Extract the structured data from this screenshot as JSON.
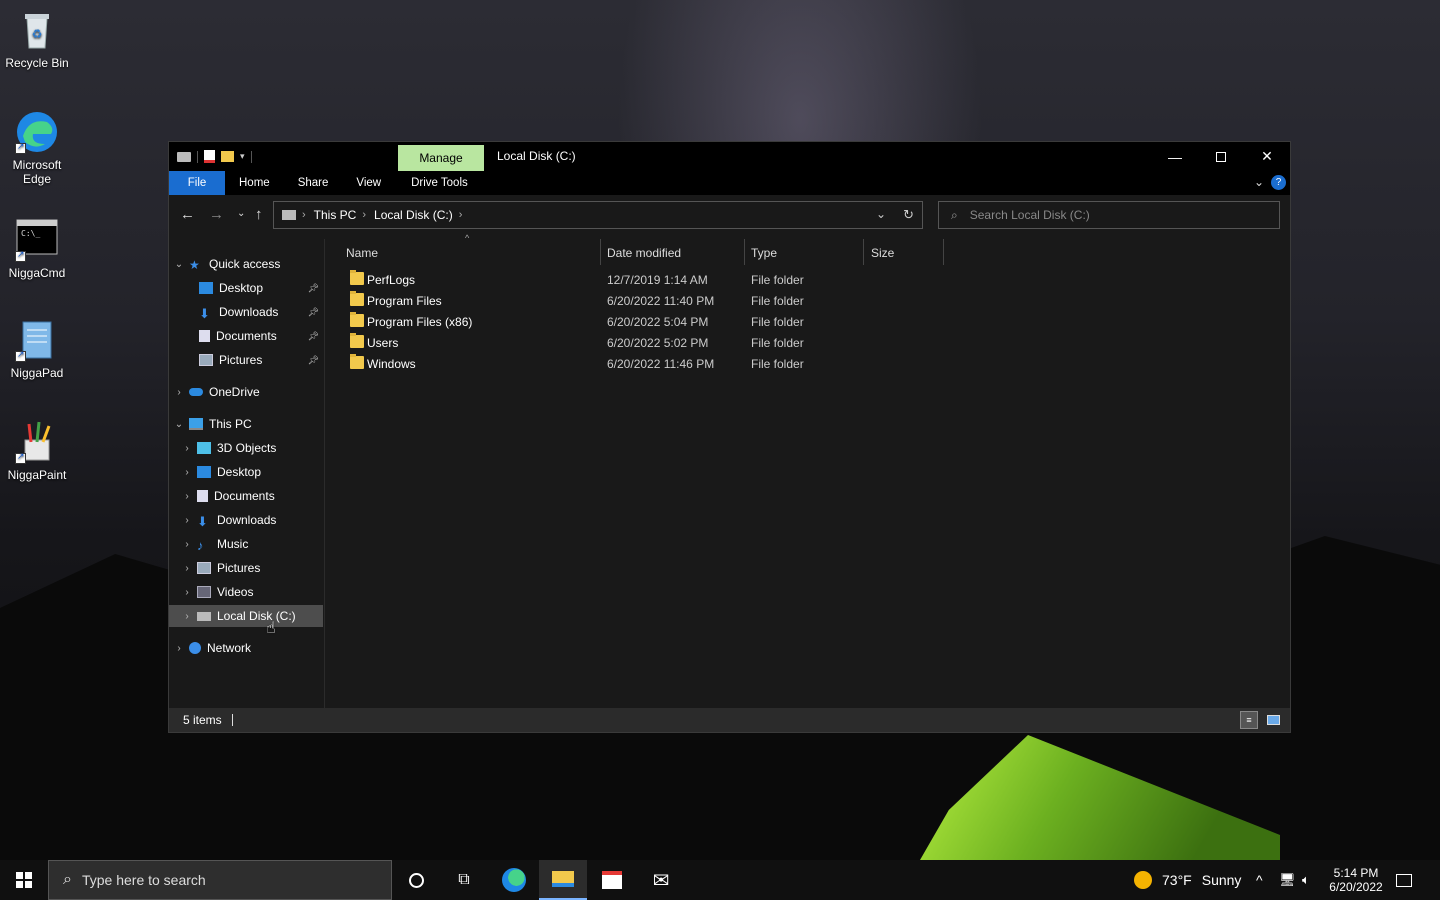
{
  "desktop": {
    "icons": [
      {
        "label": "Recycle Bin"
      },
      {
        "label": "Microsoft Edge"
      },
      {
        "label": "NiggaCmd"
      },
      {
        "label": "NiggaPad"
      },
      {
        "label": "NiggaPaint"
      }
    ]
  },
  "window": {
    "title": "Local Disk (C:)",
    "context_tab": "Manage",
    "ribbon_tabs": [
      "File",
      "Home",
      "Share",
      "View",
      "Drive Tools"
    ],
    "breadcrumb": [
      "This PC",
      "Local Disk (C:)"
    ],
    "search_placeholder": "Search Local Disk (C:)",
    "columns": [
      "Name",
      "Date modified",
      "Type",
      "Size"
    ],
    "files": [
      {
        "name": "PerfLogs",
        "date": "12/7/2019 1:14 AM",
        "type": "File folder"
      },
      {
        "name": "Program Files",
        "date": "6/20/2022 11:40 PM",
        "type": "File folder"
      },
      {
        "name": "Program Files (x86)",
        "date": "6/20/2022 5:04 PM",
        "type": "File folder"
      },
      {
        "name": "Users",
        "date": "6/20/2022 5:02 PM",
        "type": "File folder"
      },
      {
        "name": "Windows",
        "date": "6/20/2022 11:46 PM",
        "type": "File folder"
      }
    ],
    "nav": {
      "quick_access": "Quick access",
      "quick_items": [
        "Desktop",
        "Downloads",
        "Documents",
        "Pictures"
      ],
      "onedrive": "OneDrive",
      "this_pc": "This PC",
      "pc_items": [
        "3D Objects",
        "Desktop",
        "Documents",
        "Downloads",
        "Music",
        "Pictures",
        "Videos",
        "Local Disk (C:)"
      ],
      "network": "Network"
    },
    "status": "5 items"
  },
  "taskbar": {
    "search_placeholder": "Type here to search",
    "weather_temp": "73°F",
    "weather_cond": "Sunny",
    "time": "5:14 PM",
    "date": "6/20/2022"
  },
  "colors": {
    "accent": "#1a6dd0",
    "manage_tab": "#b9e6a0",
    "folder": "#f2c94c"
  }
}
